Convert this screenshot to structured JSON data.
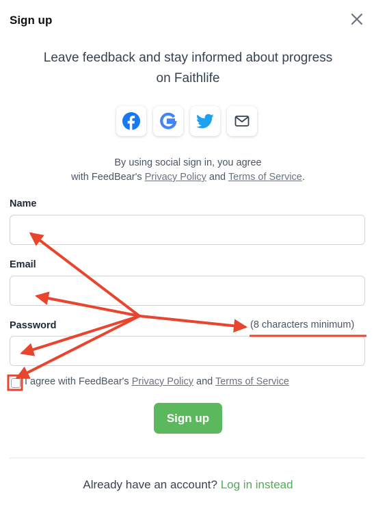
{
  "header": {
    "title": "Sign up"
  },
  "intro": {
    "line1": "Leave feedback and stay informed about progress",
    "line2": "on Faithlife"
  },
  "social": {
    "buttons": [
      {
        "name": "facebook",
        "color": "#1877f2"
      },
      {
        "name": "google",
        "color": "#4285f4"
      },
      {
        "name": "twitter",
        "color": "#1da1f2"
      },
      {
        "name": "email",
        "color": "#374151"
      }
    ],
    "note_line1": "By using social sign in, you agree",
    "note_prefix": "with FeedBear's",
    "privacy": "Privacy Policy",
    "and": "and",
    "terms": "Terms of Service",
    "period": "."
  },
  "form": {
    "name_label": "Name",
    "name_value": "",
    "email_label": "Email",
    "email_value": "",
    "password_label": "Password",
    "password_value": "",
    "password_hint": "(8 characters minimum)",
    "agree_prefix": "I agree with FeedBear's",
    "agree_privacy": "Privacy Policy",
    "agree_and": "and",
    "agree_terms": "Terms of Service",
    "agree_checked": false,
    "submit_label": "Sign up"
  },
  "footer": {
    "question": "Already have an account?",
    "login_link": "Log in instead"
  },
  "colors": {
    "accent": "#5cb85c",
    "annotation": "#e8442e",
    "link": "#4caf50"
  }
}
